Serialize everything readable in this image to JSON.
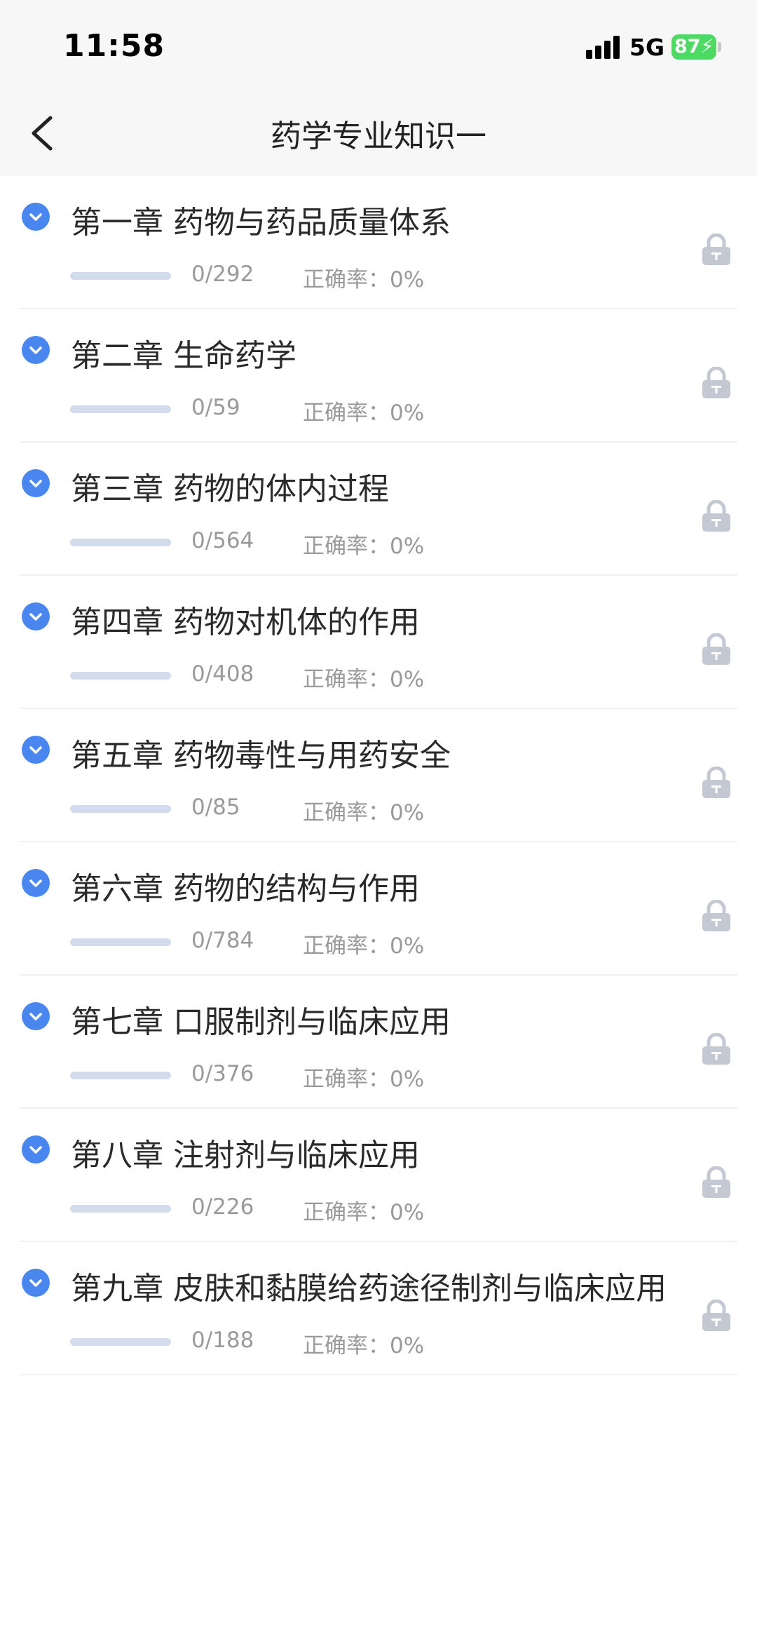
{
  "status_bar": {
    "time": "11:58",
    "network": "5G",
    "battery": "87"
  },
  "nav": {
    "title": "药学专业知识一",
    "back_icon": "chevron-left-icon"
  },
  "colors": {
    "accent": "#4a86f0",
    "progress_track": "#d3dcec",
    "lock": "#c3c8d2",
    "battery": "#4cd964"
  },
  "chapters": [
    {
      "title": "第一章 药物与药品质量体系",
      "count": "0/292",
      "accuracy": "正确率：0%",
      "progress": 0
    },
    {
      "title": "第二章 生命药学",
      "count": "0/59",
      "accuracy": "正确率：0%",
      "progress": 0
    },
    {
      "title": "第三章 药物的体内过程",
      "count": "0/564",
      "accuracy": "正确率：0%",
      "progress": 0
    },
    {
      "title": "第四章 药物对机体的作用",
      "count": "0/408",
      "accuracy": "正确率：0%",
      "progress": 0
    },
    {
      "title": "第五章 药物毒性与用药安全",
      "count": "0/85",
      "accuracy": "正确率：0%",
      "progress": 0
    },
    {
      "title": "第六章 药物的结构与作用",
      "count": "0/784",
      "accuracy": "正确率：0%",
      "progress": 0
    },
    {
      "title": "第七章 口服制剂与临床应用",
      "count": "0/376",
      "accuracy": "正确率：0%",
      "progress": 0
    },
    {
      "title": "第八章 注射剂与临床应用",
      "count": "0/226",
      "accuracy": "正确率：0%",
      "progress": 0
    },
    {
      "title": "第九章 皮肤和黏膜给药途径制剂与临床应用",
      "count": "0/188",
      "accuracy": "正确率：0%",
      "progress": 0
    }
  ]
}
